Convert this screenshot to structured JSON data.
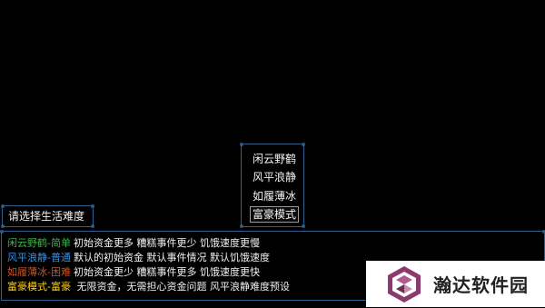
{
  "difficulty_menu": {
    "items": [
      {
        "label": "闲云野鹤"
      },
      {
        "label": "风平浪静"
      },
      {
        "label": "如履薄冰"
      },
      {
        "label": "富豪模式"
      }
    ],
    "selected_index": 3
  },
  "prompt": {
    "label": "请选择生活难度"
  },
  "descriptions": [
    {
      "mode": "闲云野鹤-简单",
      "text": "初始资金更多  糟糕事件更少 饥饿速度更慢",
      "color": "#3cb54a"
    },
    {
      "mode": "风平浪静-普通",
      "text": "默认的初始资金 默认事件情况 默认饥饿速度",
      "color": "#3a8fe0"
    },
    {
      "mode": "如履薄冰-困难",
      "text": "初始资金更少  糟糕事件更多 饥饿速度更快",
      "color": "#c8542a"
    },
    {
      "mode": "富豪模式-富豪",
      "text": " 无限资金，无需担心资金问题 风平浪静难度预设",
      "color": "#ffd21f"
    }
  ],
  "watermark": {
    "text": "瀚达软件园",
    "icon": "hexagon-logo-icon"
  },
  "colors": {
    "panel_border": "#2f5f8f",
    "background": "#000000"
  }
}
